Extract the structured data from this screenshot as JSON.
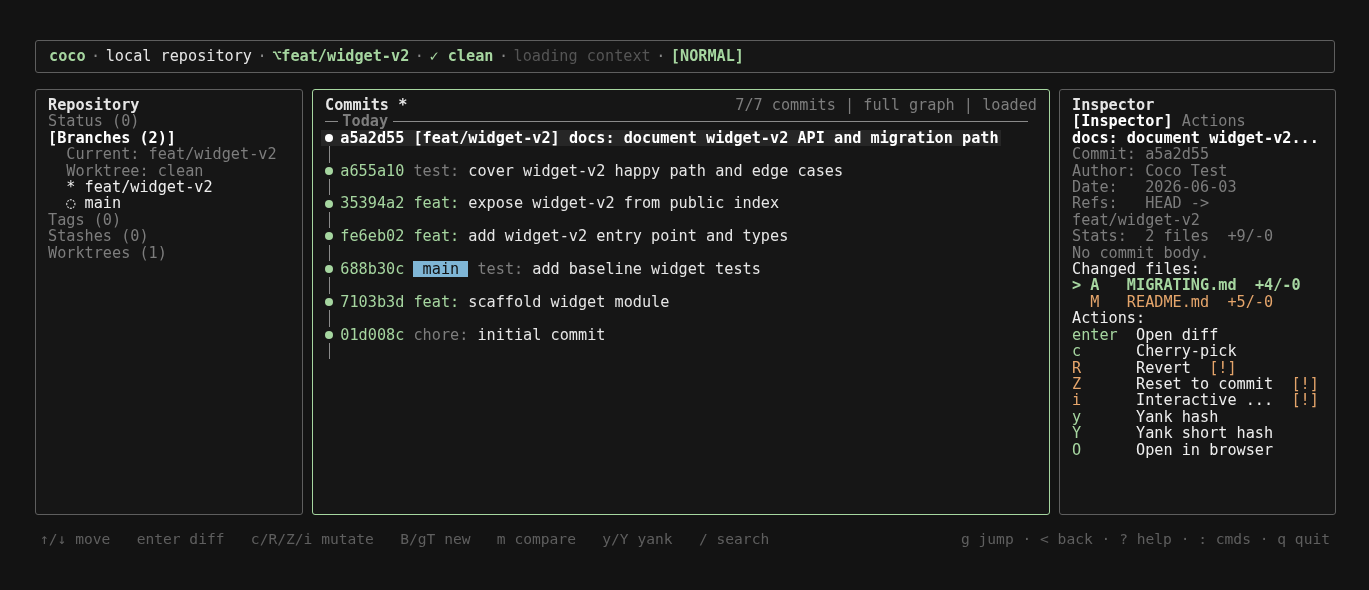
{
  "header": {
    "items": [
      {
        "text": "coco",
        "kind": "app"
      },
      {
        "text": "·",
        "kind": "sep"
      },
      {
        "text": "local repository",
        "kind": "plain"
      },
      {
        "text": "·",
        "kind": "sep"
      },
      {
        "text": "⌥feat/widget-v2",
        "kind": "accent"
      },
      {
        "text": "·",
        "kind": "sep"
      },
      {
        "text": "✓ clean",
        "kind": "accent"
      },
      {
        "text": "·",
        "kind": "sep"
      },
      {
        "text": "loading context",
        "kind": "faint"
      },
      {
        "text": "·",
        "kind": "sep"
      },
      {
        "text": "[NORMAL]",
        "kind": "accent"
      }
    ]
  },
  "repository": {
    "title": "Repository",
    "items": [
      {
        "label": "Status (0)",
        "selected": false
      },
      {
        "label": "[Branches (2)]",
        "selected": true,
        "children": [
          {
            "label": "Current: feat/widget-v2",
            "kind": "info"
          },
          {
            "label": "Worktree: clean",
            "kind": "info"
          },
          {
            "label": "* feat/widget-v2",
            "kind": "branch"
          },
          {
            "label": "◌ main",
            "kind": "branch"
          }
        ]
      },
      {
        "label": "Tags (0)",
        "selected": false
      },
      {
        "label": "Stashes (0)",
        "selected": false
      },
      {
        "label": "Worktrees (1)",
        "selected": false
      }
    ]
  },
  "commits": {
    "title": "Commits *",
    "meta": "7/7 commits | full graph | loaded",
    "group": "Today",
    "rows": [
      {
        "hash": "a5a2d55",
        "ref": {
          "label": "[feat/widget-v2]",
          "kind": "bracket"
        },
        "type": "docs:",
        "kind": "muted",
        "subject": "document widget-v2 API and migration path",
        "selected": true
      },
      {
        "hash": "a655a10",
        "type": "test:",
        "kind": "muted",
        "subject": "cover widget-v2 happy path and edge cases",
        "selected": false
      },
      {
        "hash": "35394a2",
        "type": "feat:",
        "kind": "accented",
        "subject": "expose widget-v2 from public index",
        "selected": false
      },
      {
        "hash": "fe6eb02",
        "type": "feat:",
        "kind": "accented",
        "subject": "add widget-v2 entry point and types",
        "selected": false
      },
      {
        "hash": "688b30c",
        "ref": {
          "label": "main",
          "kind": "badge"
        },
        "type": "test:",
        "kind": "muted",
        "subject": "add baseline widget tests",
        "selected": false
      },
      {
        "hash": "7103b3d",
        "type": "feat:",
        "kind": "accented",
        "subject": "scaffold widget module",
        "selected": false
      },
      {
        "hash": "01d008c",
        "type": "chore:",
        "kind": "muted",
        "subject": "initial commit",
        "selected": false
      }
    ]
  },
  "inspector": {
    "title": "Inspector",
    "tabs": [
      {
        "label": "[Inspector]",
        "selected": true
      },
      {
        "label": "Actions",
        "selected": false
      }
    ],
    "subject": "docs: document widget-v2...",
    "details": [
      "Commit: a5a2d55",
      "Author: Coco Test",
      "Date:   2026-06-03",
      "Refs:   HEAD ->",
      "feat/widget-v2",
      "Stats:  2 files  +9/-0",
      "No commit body."
    ],
    "files_heading": "Changed files:",
    "cursor": ">",
    "files": [
      {
        "status": "A",
        "name": "MIGRATING.md",
        "stat": "+4/-0",
        "kind": "added",
        "selected": true
      },
      {
        "status": "M",
        "name": "README.md",
        "stat": "+5/-0",
        "kind": "modified",
        "selected": false
      }
    ],
    "actions_heading": "Actions:",
    "actions": [
      {
        "key": "enter",
        "label": "Open diff",
        "destructive": false
      },
      {
        "key": "c",
        "label": "Cherry-pick",
        "destructive": false
      },
      {
        "key": "R",
        "label": "Revert",
        "destructive": true,
        "warning": "[!]"
      },
      {
        "key": "Z",
        "label": "Reset to commit",
        "destructive": true,
        "warning": "[!]"
      },
      {
        "key": "i",
        "label": "Interactive ...",
        "destructive": true,
        "warning": "[!]"
      },
      {
        "key": "y",
        "label": "Yank hash",
        "destructive": false
      },
      {
        "key": "Y",
        "label": "Yank short hash",
        "destructive": false
      },
      {
        "key": "O",
        "label": "Open in browser",
        "destructive": false
      }
    ]
  },
  "footer": {
    "left": [
      "↑/↓ move",
      "enter diff",
      "c/R/Z/i mutate",
      "B/gT new",
      "m compare",
      "y/Y yank",
      "/ search"
    ],
    "right": [
      "g jump",
      "·",
      "< back",
      "·",
      "? help",
      "·",
      ": cmds",
      "·",
      "q quit"
    ]
  }
}
